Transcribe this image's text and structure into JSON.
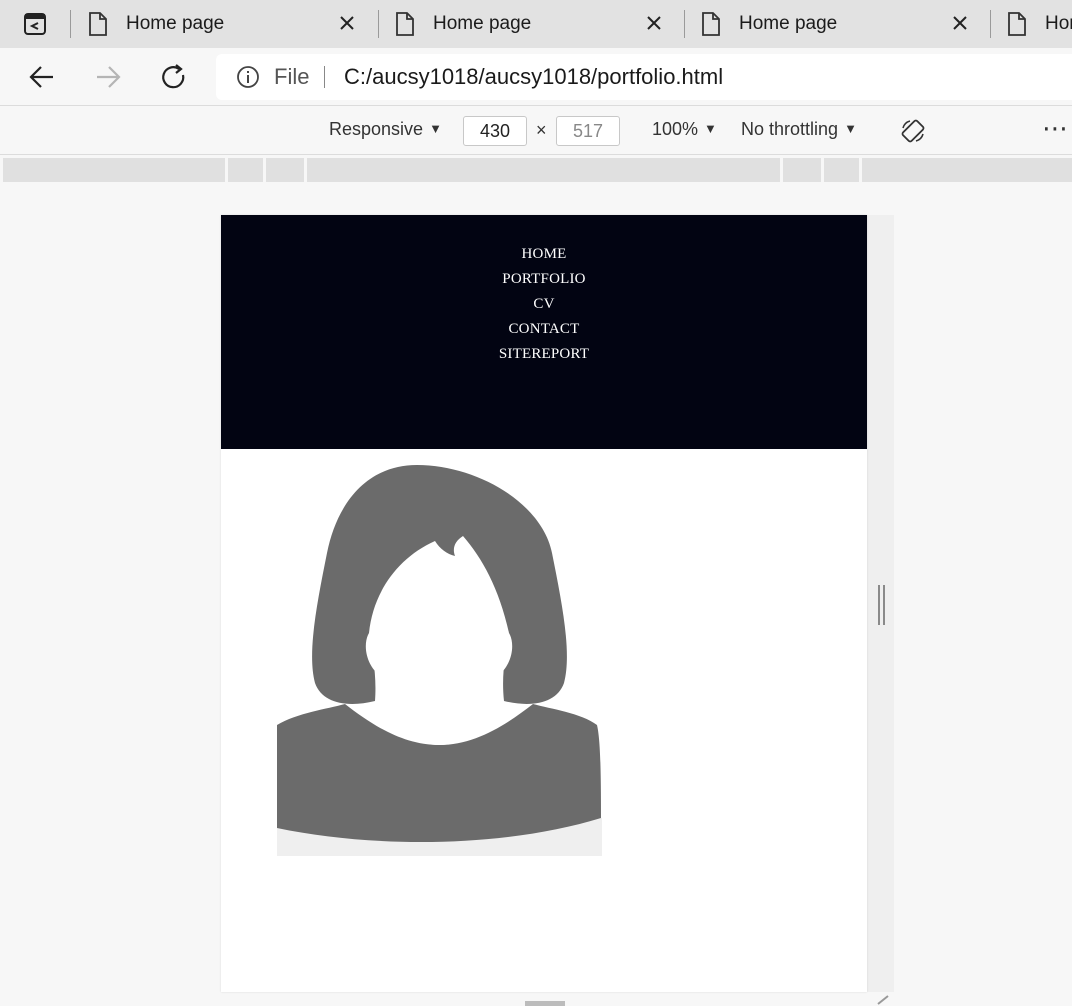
{
  "browser": {
    "tabs": [
      {
        "title": "Home page"
      },
      {
        "title": "Home page"
      },
      {
        "title": "Home page"
      },
      {
        "title": "Hor"
      }
    ],
    "address": {
      "scheme_label": "File",
      "url": "C:/aucsy1018/aucsy1018/portfolio.html"
    }
  },
  "device_toolbar": {
    "device": "Responsive",
    "width": "430",
    "height": "517",
    "times": "×",
    "zoom": "100%",
    "throttling": "No throttling",
    "more": "⋯"
  },
  "site": {
    "nav": [
      "HOME",
      "PORTFOLIO",
      "CV",
      "CONTACT",
      "SITEREPORT"
    ],
    "header_color": "#020412",
    "avatar_icon": "female-avatar-placeholder"
  }
}
